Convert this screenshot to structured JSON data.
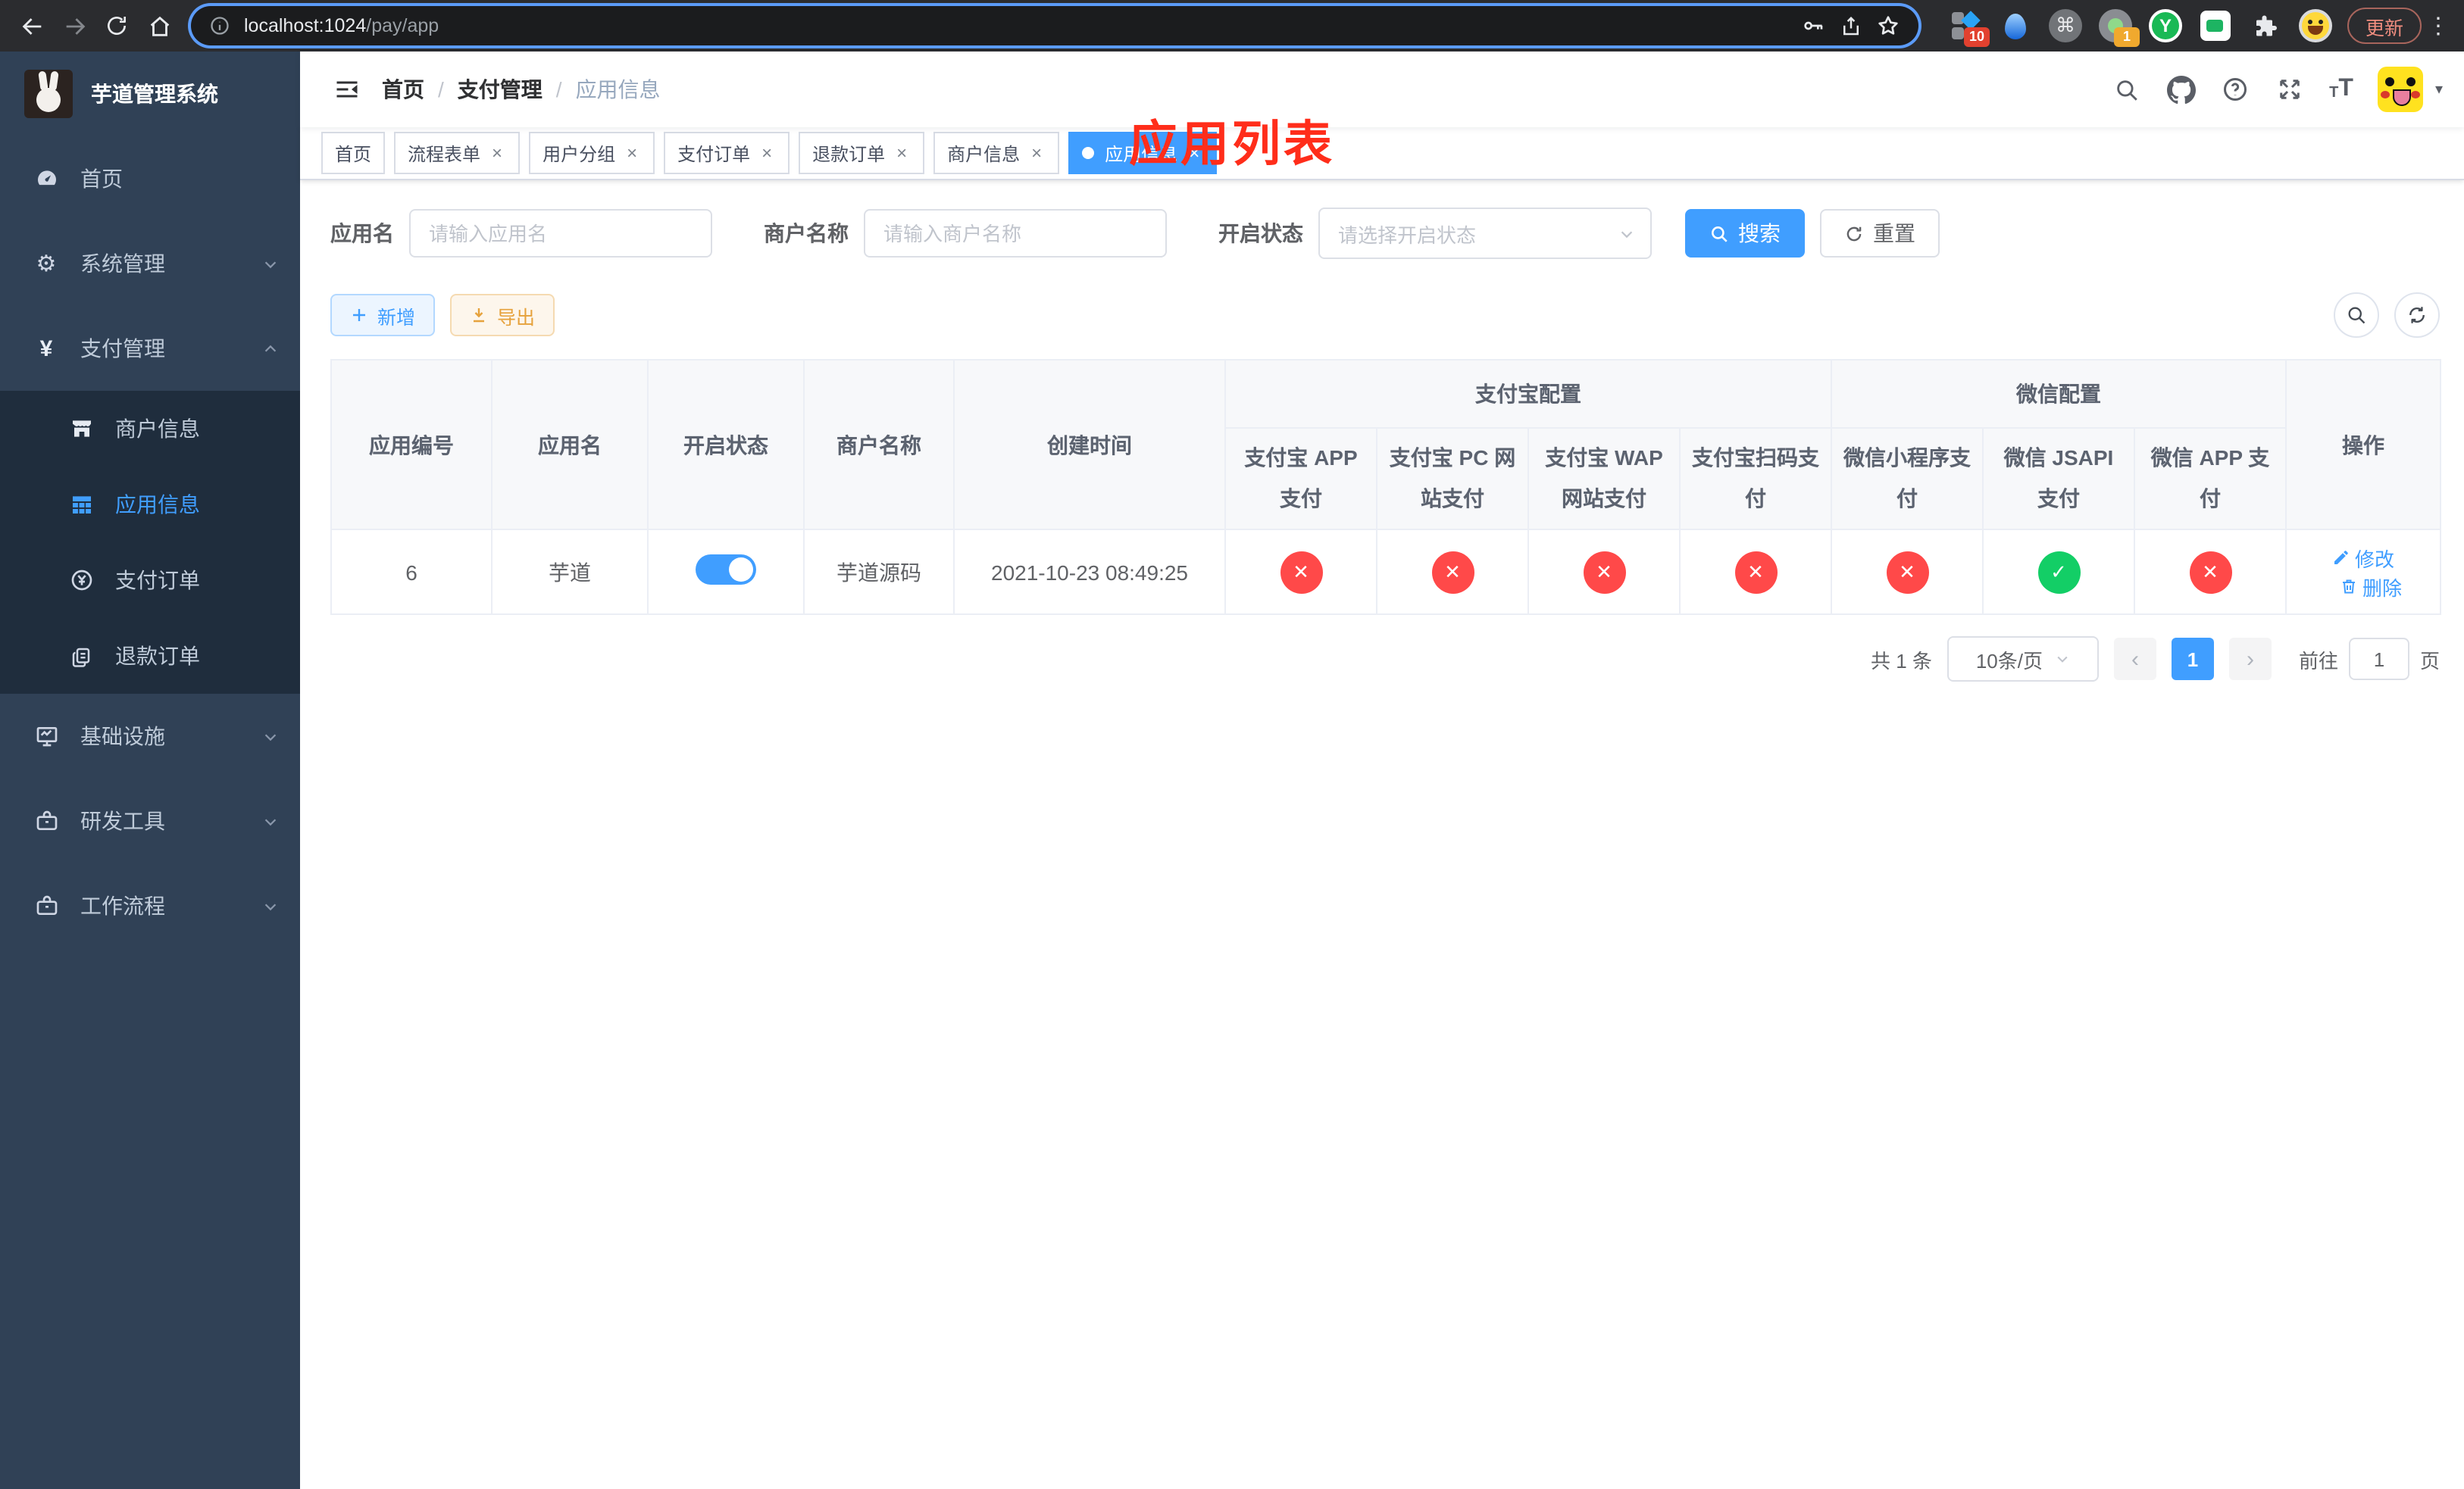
{
  "colors": {
    "primary": "#409eff",
    "success": "#13ce66",
    "danger": "#ff4949",
    "warning": "#e6a23c",
    "sidebar_bg": "#304156",
    "submenu_bg": "#1f2d3d",
    "annotation_red": "#ff2d1a"
  },
  "icons": {
    "close": "×",
    "check": "✓",
    "cross": "✕",
    "gear": "⚙",
    "yen": "¥",
    "cmd": "⌘",
    "menu_dots": "⋮",
    "caret_down": "▾",
    "prev": "‹",
    "next": "›",
    "breadcrumb_separator": "/"
  },
  "browser": {
    "url_host": "localhost:1024",
    "url_path": "/pay/app",
    "update_button": "更新",
    "extension_badge_10": "10",
    "extension_badge_1": "1",
    "ext_y_letter": "Y"
  },
  "sidebar": {
    "title": "芋道管理系统",
    "items": [
      {
        "label": "首页"
      },
      {
        "label": "系统管理"
      },
      {
        "label": "支付管理"
      },
      {
        "label": "基础设施"
      },
      {
        "label": "研发工具"
      },
      {
        "label": "工作流程"
      }
    ],
    "submenu": [
      {
        "label": "商户信息"
      },
      {
        "label": "应用信息"
      },
      {
        "label": "支付订单"
      },
      {
        "label": "退款订单"
      }
    ]
  },
  "navbar": {
    "breadcrumb": [
      "首页",
      "支付管理",
      "应用信息"
    ],
    "annotation": "应用列表"
  },
  "tabs": [
    {
      "label": "首页",
      "closable": false,
      "active": false
    },
    {
      "label": "流程表单",
      "closable": true,
      "active": false
    },
    {
      "label": "用户分组",
      "closable": true,
      "active": false
    },
    {
      "label": "支付订单",
      "closable": true,
      "active": false
    },
    {
      "label": "退款订单",
      "closable": true,
      "active": false
    },
    {
      "label": "商户信息",
      "closable": true,
      "active": false
    },
    {
      "label": "应用信息",
      "closable": true,
      "active": true
    }
  ],
  "filters": {
    "app_name": {
      "label": "应用名",
      "placeholder": "请输入应用名"
    },
    "merchant_name": {
      "label": "商户名称",
      "placeholder": "请输入商户名称"
    },
    "status": {
      "label": "开启状态",
      "placeholder": "请选择开启状态"
    },
    "search_button": "搜索",
    "reset_button": "重置"
  },
  "toolbar": {
    "add_button": "新增",
    "export_button": "导出"
  },
  "table": {
    "main_columns": [
      "应用编号",
      "应用名",
      "开启状态",
      "商户名称",
      "创建时间",
      "操作"
    ],
    "groups": {
      "alipay": "支付宝配置",
      "wechat": "微信配置"
    },
    "sub_columns": [
      "支付宝 APP 支付",
      "支付宝 PC 网站支付",
      "支付宝 WAP 网站支付",
      "支付宝扫码支付",
      "微信小程序支付",
      "微信 JSAPI 支付",
      "微信 APP 支付"
    ],
    "row": {
      "id": "6",
      "name": "芋道",
      "enabled": true,
      "merchant": "芋道源码",
      "created_at": "2021-10-23 08:49:25",
      "configs": [
        false,
        false,
        false,
        false,
        false,
        true,
        false
      ],
      "edit_label": "修改",
      "delete_label": "删除"
    }
  },
  "pagination": {
    "total": "共 1 条",
    "page_size": "10条/页",
    "current_page": "1",
    "goto_label": "前往",
    "goto_value": "1",
    "page_unit": "页"
  }
}
